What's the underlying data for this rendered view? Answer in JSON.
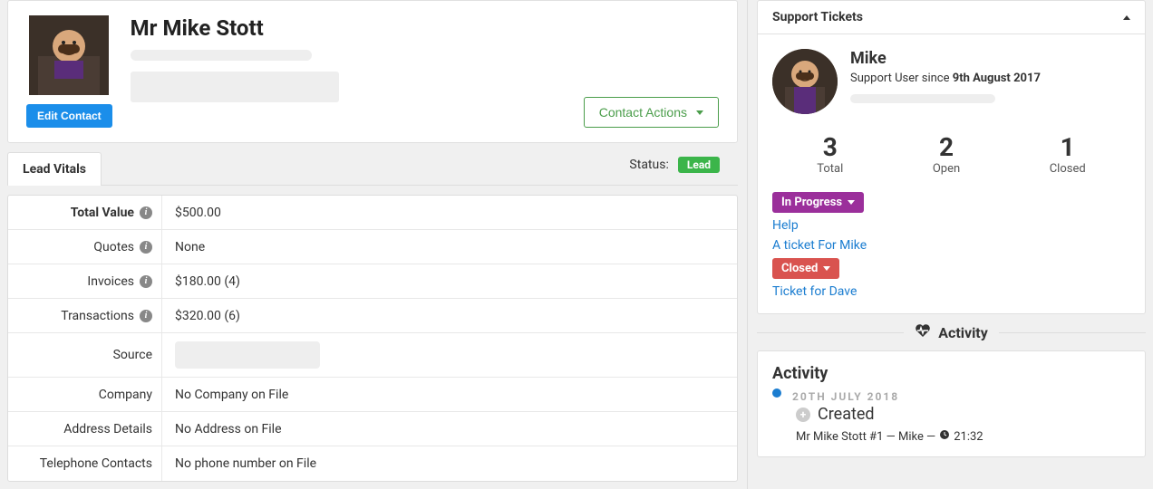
{
  "contact": {
    "name": "Mr Mike Stott",
    "edit_label": "Edit Contact",
    "actions_label": "Contact Actions"
  },
  "tabs": {
    "lead_vitals": "Lead Vitals",
    "status_label": "Status:",
    "status_badge": "Lead"
  },
  "vitals": {
    "rows": [
      {
        "label": "Total Value",
        "value": "$500.00",
        "info": true,
        "bold": true
      },
      {
        "label": "Quotes",
        "value": "None",
        "info": true
      },
      {
        "label": "Invoices",
        "value": "$180.00 (4)",
        "info": true
      },
      {
        "label": "Transactions",
        "value": "$320.00 (6)",
        "info": true
      },
      {
        "label": "Source",
        "value": "",
        "placeholder": true
      },
      {
        "label": "Company",
        "value": "No Company on File"
      },
      {
        "label": "Address Details",
        "value": "No Address on File"
      },
      {
        "label": "Telephone Contacts",
        "value": "No phone number on File"
      }
    ]
  },
  "support": {
    "panel_title": "Support Tickets",
    "user_name": "Mike",
    "since_prefix": "Support User since ",
    "since_date": "9th August 2017",
    "stats": [
      {
        "num": "3",
        "label": "Total"
      },
      {
        "num": "2",
        "label": "Open"
      },
      {
        "num": "1",
        "label": "Closed"
      }
    ],
    "groups": [
      {
        "status": "In Progress",
        "class": "badge-inprogress",
        "tickets": [
          "Help",
          "A ticket For Mike"
        ]
      },
      {
        "status": "Closed",
        "class": "badge-closed",
        "tickets": [
          "Ticket for Dave"
        ]
      }
    ]
  },
  "activity": {
    "section_label": "Activity",
    "title": "Activity",
    "date": "20TH JULY 2018",
    "event": "Created",
    "desc_prefix": "Mr Mike Stott #1 — Mike — ",
    "time": "21:32"
  }
}
